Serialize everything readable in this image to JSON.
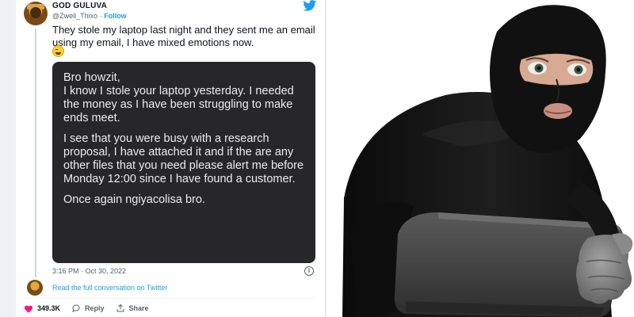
{
  "tweet": {
    "display_name": "GOD GULUVA",
    "handle": "@Zweli_Thixo",
    "separator": "·",
    "follow_label": "Follow",
    "text": "They stole my laptop last night and they sent me an email using my email, I have mixed emotions now.",
    "emoji": "weary-face",
    "image_text": [
      "Bro howzit,\nI know I stole your laptop yesterday. I needed the money as I have been struggling to make ends meet.",
      "I see that you were busy with a research proposal, I have attached it and if the are any other files that you need please alert me before Monday 12:00 since I have found a customer.",
      "Once again ngiyacolisa bro."
    ],
    "timestamp": "3:16 PM · Oct 30, 2022",
    "info_icon_glyph": "i",
    "read_more_label": "Read the full conversation on Twitter",
    "likes_count": "349.3K",
    "reply_label": "Reply",
    "share_label": "Share"
  },
  "colors": {
    "twitter_blue": "#1d9bf0",
    "like_red": "#f91880",
    "card_dark": "#272729"
  },
  "icons": [
    "twitter-bird-icon",
    "heart-icon",
    "reply-bubble-icon",
    "share-icon",
    "info-icon"
  ],
  "photo": {
    "subject": "masked-thief-with-laptop"
  }
}
